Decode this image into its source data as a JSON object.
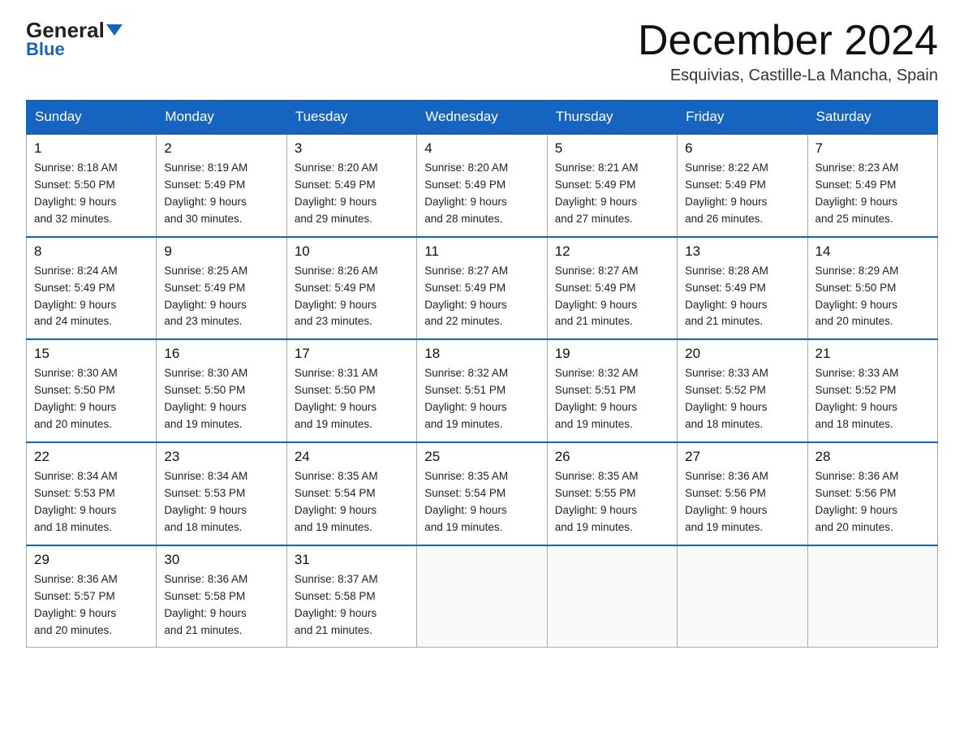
{
  "header": {
    "logo_general": "General",
    "logo_blue": "Blue",
    "month_title": "December 2024",
    "location": "Esquivias, Castille-La Mancha, Spain"
  },
  "weekdays": [
    "Sunday",
    "Monday",
    "Tuesday",
    "Wednesday",
    "Thursday",
    "Friday",
    "Saturday"
  ],
  "weeks": [
    [
      {
        "day": "1",
        "sunrise": "Sunrise: 8:18 AM",
        "sunset": "Sunset: 5:50 PM",
        "daylight": "Daylight: 9 hours and 32 minutes."
      },
      {
        "day": "2",
        "sunrise": "Sunrise: 8:19 AM",
        "sunset": "Sunset: 5:49 PM",
        "daylight": "Daylight: 9 hours and 30 minutes."
      },
      {
        "day": "3",
        "sunrise": "Sunrise: 8:20 AM",
        "sunset": "Sunset: 5:49 PM",
        "daylight": "Daylight: 9 hours and 29 minutes."
      },
      {
        "day": "4",
        "sunrise": "Sunrise: 8:20 AM",
        "sunset": "Sunset: 5:49 PM",
        "daylight": "Daylight: 9 hours and 28 minutes."
      },
      {
        "day": "5",
        "sunrise": "Sunrise: 8:21 AM",
        "sunset": "Sunset: 5:49 PM",
        "daylight": "Daylight: 9 hours and 27 minutes."
      },
      {
        "day": "6",
        "sunrise": "Sunrise: 8:22 AM",
        "sunset": "Sunset: 5:49 PM",
        "daylight": "Daylight: 9 hours and 26 minutes."
      },
      {
        "day": "7",
        "sunrise": "Sunrise: 8:23 AM",
        "sunset": "Sunset: 5:49 PM",
        "daylight": "Daylight: 9 hours and 25 minutes."
      }
    ],
    [
      {
        "day": "8",
        "sunrise": "Sunrise: 8:24 AM",
        "sunset": "Sunset: 5:49 PM",
        "daylight": "Daylight: 9 hours and 24 minutes."
      },
      {
        "day": "9",
        "sunrise": "Sunrise: 8:25 AM",
        "sunset": "Sunset: 5:49 PM",
        "daylight": "Daylight: 9 hours and 23 minutes."
      },
      {
        "day": "10",
        "sunrise": "Sunrise: 8:26 AM",
        "sunset": "Sunset: 5:49 PM",
        "daylight": "Daylight: 9 hours and 23 minutes."
      },
      {
        "day": "11",
        "sunrise": "Sunrise: 8:27 AM",
        "sunset": "Sunset: 5:49 PM",
        "daylight": "Daylight: 9 hours and 22 minutes."
      },
      {
        "day": "12",
        "sunrise": "Sunrise: 8:27 AM",
        "sunset": "Sunset: 5:49 PM",
        "daylight": "Daylight: 9 hours and 21 minutes."
      },
      {
        "day": "13",
        "sunrise": "Sunrise: 8:28 AM",
        "sunset": "Sunset: 5:49 PM",
        "daylight": "Daylight: 9 hours and 21 minutes."
      },
      {
        "day": "14",
        "sunrise": "Sunrise: 8:29 AM",
        "sunset": "Sunset: 5:50 PM",
        "daylight": "Daylight: 9 hours and 20 minutes."
      }
    ],
    [
      {
        "day": "15",
        "sunrise": "Sunrise: 8:30 AM",
        "sunset": "Sunset: 5:50 PM",
        "daylight": "Daylight: 9 hours and 20 minutes."
      },
      {
        "day": "16",
        "sunrise": "Sunrise: 8:30 AM",
        "sunset": "Sunset: 5:50 PM",
        "daylight": "Daylight: 9 hours and 19 minutes."
      },
      {
        "day": "17",
        "sunrise": "Sunrise: 8:31 AM",
        "sunset": "Sunset: 5:50 PM",
        "daylight": "Daylight: 9 hours and 19 minutes."
      },
      {
        "day": "18",
        "sunrise": "Sunrise: 8:32 AM",
        "sunset": "Sunset: 5:51 PM",
        "daylight": "Daylight: 9 hours and 19 minutes."
      },
      {
        "day": "19",
        "sunrise": "Sunrise: 8:32 AM",
        "sunset": "Sunset: 5:51 PM",
        "daylight": "Daylight: 9 hours and 19 minutes."
      },
      {
        "day": "20",
        "sunrise": "Sunrise: 8:33 AM",
        "sunset": "Sunset: 5:52 PM",
        "daylight": "Daylight: 9 hours and 18 minutes."
      },
      {
        "day": "21",
        "sunrise": "Sunrise: 8:33 AM",
        "sunset": "Sunset: 5:52 PM",
        "daylight": "Daylight: 9 hours and 18 minutes."
      }
    ],
    [
      {
        "day": "22",
        "sunrise": "Sunrise: 8:34 AM",
        "sunset": "Sunset: 5:53 PM",
        "daylight": "Daylight: 9 hours and 18 minutes."
      },
      {
        "day": "23",
        "sunrise": "Sunrise: 8:34 AM",
        "sunset": "Sunset: 5:53 PM",
        "daylight": "Daylight: 9 hours and 18 minutes."
      },
      {
        "day": "24",
        "sunrise": "Sunrise: 8:35 AM",
        "sunset": "Sunset: 5:54 PM",
        "daylight": "Daylight: 9 hours and 19 minutes."
      },
      {
        "day": "25",
        "sunrise": "Sunrise: 8:35 AM",
        "sunset": "Sunset: 5:54 PM",
        "daylight": "Daylight: 9 hours and 19 minutes."
      },
      {
        "day": "26",
        "sunrise": "Sunrise: 8:35 AM",
        "sunset": "Sunset: 5:55 PM",
        "daylight": "Daylight: 9 hours and 19 minutes."
      },
      {
        "day": "27",
        "sunrise": "Sunrise: 8:36 AM",
        "sunset": "Sunset: 5:56 PM",
        "daylight": "Daylight: 9 hours and 19 minutes."
      },
      {
        "day": "28",
        "sunrise": "Sunrise: 8:36 AM",
        "sunset": "Sunset: 5:56 PM",
        "daylight": "Daylight: 9 hours and 20 minutes."
      }
    ],
    [
      {
        "day": "29",
        "sunrise": "Sunrise: 8:36 AM",
        "sunset": "Sunset: 5:57 PM",
        "daylight": "Daylight: 9 hours and 20 minutes."
      },
      {
        "day": "30",
        "sunrise": "Sunrise: 8:36 AM",
        "sunset": "Sunset: 5:58 PM",
        "daylight": "Daylight: 9 hours and 21 minutes."
      },
      {
        "day": "31",
        "sunrise": "Sunrise: 8:37 AM",
        "sunset": "Sunset: 5:58 PM",
        "daylight": "Daylight: 9 hours and 21 minutes."
      },
      null,
      null,
      null,
      null
    ]
  ]
}
